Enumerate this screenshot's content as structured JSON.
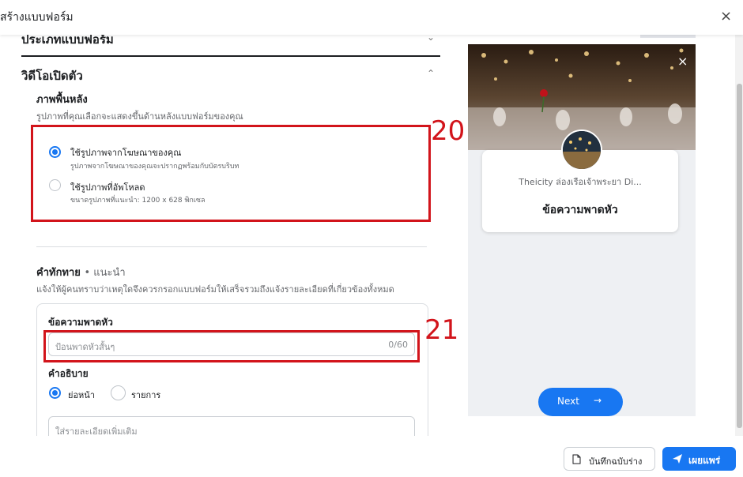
{
  "title": "สร้างแบบฟอร์ม",
  "close_glyph": "×",
  "sections": {
    "form_type": "ประเภทแบบฟอร์ม",
    "intro_video": "วิดีโอเปิดตัว"
  },
  "background": {
    "heading": "ภาพพื้นหลัง",
    "desc": "รูปภาพที่คุณเลือกจะแสดงขึ้นด้านหลังแบบฟอร์มของคุณ",
    "options": [
      {
        "label": "ใช้รูปภาพจากโฆษณาของคุณ",
        "sub": "รูปภาพจากโฆษณาของคุณจะปรากฏพร้อมกับบัตรบริบท",
        "selected": true
      },
      {
        "label": "ใช้รูปภาพที่อัพโหลด",
        "sub": "ขนาดรูปภาพที่แนะนำ: 1200 x 628 พิกเซล",
        "selected": false
      }
    ]
  },
  "greeting": {
    "heading": "คำทักทาย",
    "recommended": "• แนะนำ",
    "desc": "แจ้งให้ผู้คนทราบว่าเหตุใดจึงควรกรอกแบบฟอร์มให้เสร็จรวมถึงแจ้งรายละเอียดที่เกี่ยวข้องทั้งหมด",
    "headline_label": "ข้อความพาดหัว",
    "headline_placeholder": "ป้อนพาดหัวสั้นๆ",
    "headline_count": "0/60",
    "description_label": "คำอธิบาย",
    "desc_options": [
      {
        "label": "ย่อหน้า",
        "selected": true
      },
      {
        "label": "รายการ",
        "selected": false
      }
    ],
    "desc_placeholder": "ใส่รายละเอียดเพิ่มเติม"
  },
  "annotations": {
    "a20": "20",
    "a21": "21"
  },
  "preview": {
    "page_name": "Theicity ล่องเรือเจ้าพระยา Di...",
    "headline": "ข้อความพาดหัว",
    "next_label": "Next",
    "arrow": "→",
    "close_glyph": "×"
  },
  "footer": {
    "draft_label": "บันทึกฉบับร่าง",
    "publish_label": "เผยแพร่"
  },
  "colors": {
    "accent": "#1877f2",
    "annotation": "#d2141b"
  }
}
